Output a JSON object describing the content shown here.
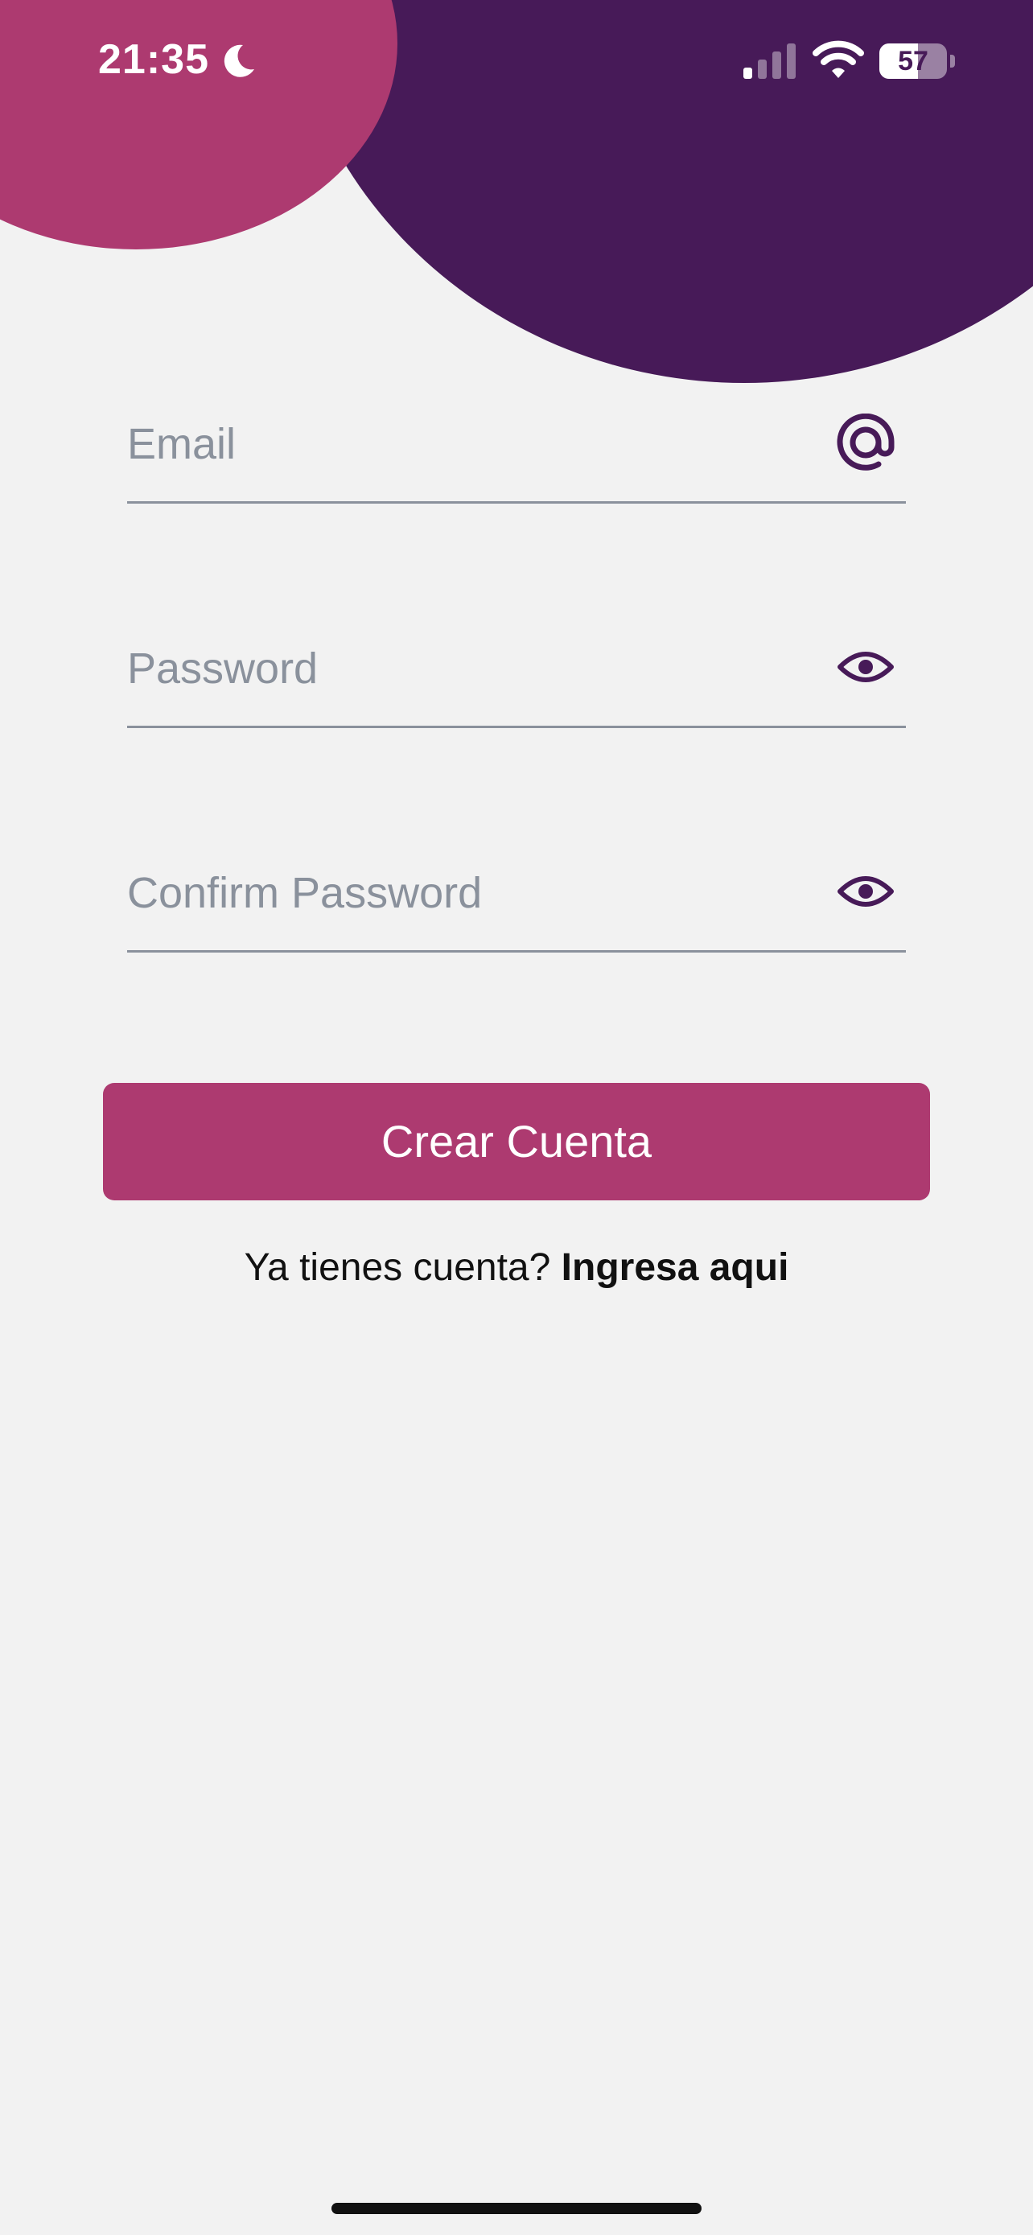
{
  "status_bar": {
    "time": "21:35",
    "battery_level": 57,
    "battery_label": "57",
    "icons": [
      "moon-icon",
      "cellular-signal-icon",
      "wifi-icon",
      "battery-icon"
    ]
  },
  "form": {
    "email": {
      "placeholder": "Email",
      "value": "",
      "icon": "at-sign-icon"
    },
    "password": {
      "placeholder": "Password",
      "value": "",
      "icon": "eye-icon"
    },
    "confirm_password": {
      "placeholder": "Confirm Password",
      "value": "",
      "icon": "eye-icon"
    }
  },
  "create_button": {
    "label": "Crear Cuenta"
  },
  "login_prompt": {
    "text": "Ya tienes cuenta?",
    "link": "Ingresa aqui"
  },
  "colors": {
    "background": "#f2f2f2",
    "pink": "#ad3a70",
    "purple": "#471a58",
    "underline": "#8a919c"
  }
}
